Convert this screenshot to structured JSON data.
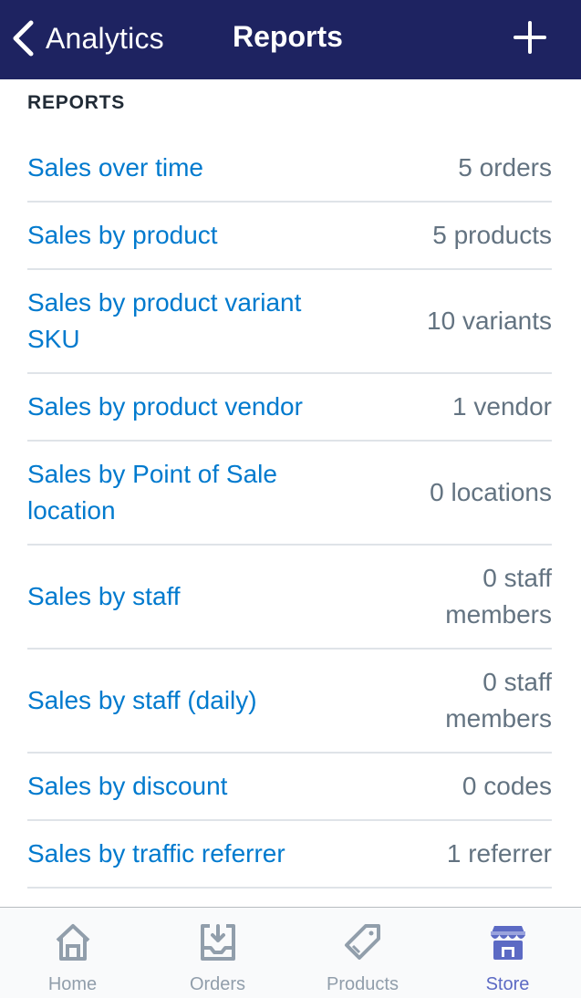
{
  "navbar": {
    "back_label": "Analytics",
    "title": "Reports",
    "back_icon": "chevron-left-icon",
    "add_icon": "plus-icon"
  },
  "section": {
    "header": "REPORTS"
  },
  "reports": [
    {
      "label": "Sales over time",
      "value": "5 orders"
    },
    {
      "label": "Sales by product",
      "value": "5 products"
    },
    {
      "label": "Sales by product variant SKU",
      "value": "10 variants"
    },
    {
      "label": "Sales by product vendor",
      "value": "1 vendor"
    },
    {
      "label": "Sales by Point of Sale location",
      "value": "0 locations"
    },
    {
      "label": "Sales by staff",
      "value": "0 staff members"
    },
    {
      "label": "Sales by staff (daily)",
      "value": "0 staff members"
    },
    {
      "label": "Sales by discount",
      "value": "0 codes"
    },
    {
      "label": "Sales by traffic referrer",
      "value": "1 referrer"
    }
  ],
  "tabbar": {
    "tabs": [
      {
        "label": "Home",
        "icon": "home-icon"
      },
      {
        "label": "Orders",
        "icon": "inbox-download-icon"
      },
      {
        "label": "Products",
        "icon": "tag-icon"
      },
      {
        "label": "Store",
        "icon": "store-icon",
        "active": true
      }
    ]
  },
  "colors": {
    "navbar": "#1e2361",
    "link": "#007ace",
    "value": "#637381",
    "tab_inactive": "#919eab",
    "tab_active": "#5c6ac4"
  }
}
